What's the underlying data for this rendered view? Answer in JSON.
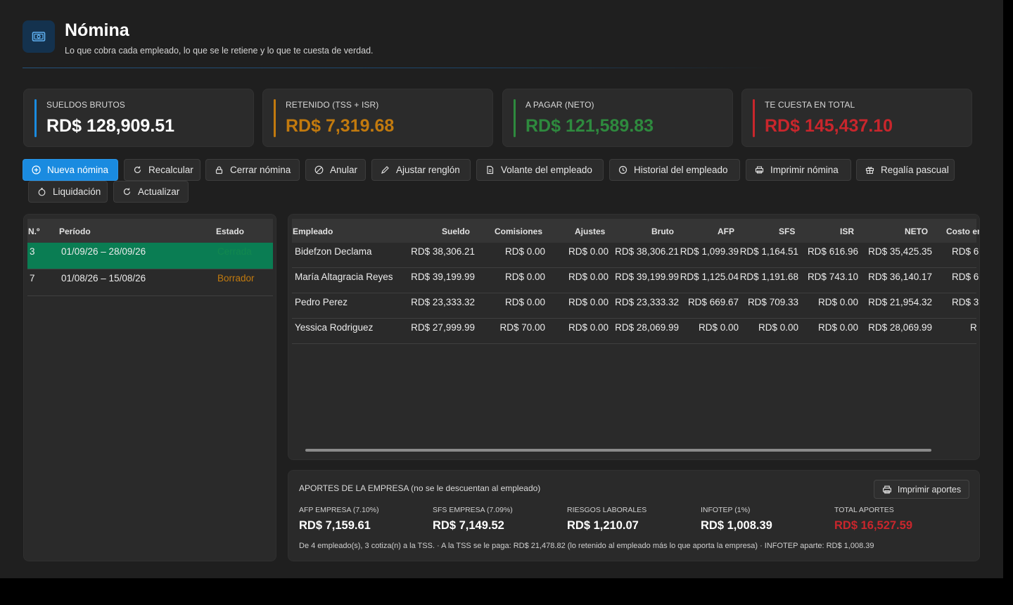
{
  "header": {
    "title": "Nómina",
    "subtitle": "Lo que cobra cada empleado, lo que se le retiene y lo que te cuesta de verdad.",
    "icon": "money-icon"
  },
  "stats": [
    {
      "label": "SUELDOS BRUTOS",
      "value": "RD$ 128,909.51",
      "color": "#1a8be0",
      "value_color": "#ffffff"
    },
    {
      "label": "RETENIDO (TSS + ISR)",
      "value": "RD$ 7,319.68",
      "color": "#c27a0e",
      "value_color": "#c27a0e"
    },
    {
      "label": "A PAGAR (NETO)",
      "value": "RD$ 121,589.83",
      "color": "#2e8a3e",
      "value_color": "#2e8a3e"
    },
    {
      "label": "TE CUESTA EN TOTAL",
      "value": "RD$ 145,437.10",
      "color": "#c9262c",
      "value_color": "#c9262c"
    }
  ],
  "toolbar": [
    {
      "label": "Nueva nómina",
      "icon": "plus-circle-icon"
    },
    {
      "label": "Recalcular",
      "icon": "refresh-icon"
    },
    {
      "label": "Cerrar nómina",
      "icon": "lock-icon"
    },
    {
      "label": "Anular",
      "icon": "cancel-icon"
    },
    {
      "label": "Ajustar renglón",
      "icon": "pencil-icon"
    },
    {
      "label": "Volante del empleado",
      "icon": "document-icon"
    },
    {
      "label": "Historial del empleado",
      "icon": "history-icon"
    },
    {
      "label": "Imprimir nómina",
      "icon": "printer-icon"
    },
    {
      "label": "Regalía pascual",
      "icon": "gift-icon"
    },
    {
      "label": "Liquidación",
      "icon": "stopwatch-icon"
    },
    {
      "label": "Actualizar",
      "icon": "refresh-icon"
    }
  ],
  "periods": {
    "columns": [
      "N.º",
      "Período",
      "Estado"
    ],
    "rows": [
      {
        "no": "3",
        "period": "01/09/26 – 28/09/26",
        "status": "Cerrada",
        "status_color": "#12884f",
        "selected": true
      },
      {
        "no": "7",
        "period": "01/08/26 – 15/08/26",
        "status": "Borrador",
        "status_color": "#c27a0e",
        "selected": false
      }
    ]
  },
  "employees": {
    "columns": [
      "Empleado",
      "Sueldo",
      "Comisiones",
      "Ajustes",
      "Bruto",
      "AFP",
      "SFS",
      "ISR",
      "NETO",
      "Costo em"
    ],
    "rows": [
      {
        "name": "Bidefzon Declama",
        "sueldo": "RD$ 38,306.21",
        "comisiones": "RD$ 0.00",
        "ajustes": "RD$ 0.00",
        "bruto": "RD$ 38,306.21",
        "afp": "RD$ 1,099.39",
        "sfs": "RD$ 1,164.51",
        "isr": "RD$ 616.96",
        "neto": "RD$ 35,425.35",
        "costo": "RD$ 6"
      },
      {
        "name": "María Altagracia Reyes",
        "sueldo": "RD$ 39,199.99",
        "comisiones": "RD$ 0.00",
        "ajustes": "RD$ 0.00",
        "bruto": "RD$ 39,199.99",
        "afp": "RD$ 1,125.04",
        "sfs": "RD$ 1,191.68",
        "isr": "RD$ 743.10",
        "neto": "RD$ 36,140.17",
        "costo": "RD$ 6"
      },
      {
        "name": "Pedro Perez",
        "sueldo": "RD$ 23,333.32",
        "comisiones": "RD$ 0.00",
        "ajustes": "RD$ 0.00",
        "bruto": "RD$ 23,333.32",
        "afp": "RD$ 669.67",
        "sfs": "RD$ 709.33",
        "isr": "RD$ 0.00",
        "neto": "RD$ 21,954.32",
        "costo": "RD$ 3"
      },
      {
        "name": "Yessica Rodriguez",
        "sueldo": "RD$ 27,999.99",
        "comisiones": "RD$ 70.00",
        "ajustes": "RD$ 0.00",
        "bruto": "RD$ 28,069.99",
        "afp": "RD$ 0.00",
        "sfs": "RD$ 0.00",
        "isr": "RD$ 0.00",
        "neto": "RD$ 28,069.99",
        "costo": "R"
      }
    ]
  },
  "aportes": {
    "title": "APORTES DE LA EMPRESA (no se le descuentan al empleado)",
    "print_label": "Imprimir aportes",
    "items": [
      {
        "label": "AFP EMPRESA (7.10%)",
        "value": "RD$ 7,159.61",
        "color": "#ffffff"
      },
      {
        "label": "SFS EMPRESA (7.09%)",
        "value": "RD$ 7,149.52",
        "color": "#ffffff"
      },
      {
        "label": "RIESGOS LABORALES",
        "value": "RD$ 1,210.07",
        "color": "#ffffff"
      },
      {
        "label": "INFOTEP (1%)",
        "value": "RD$ 1,008.39",
        "color": "#ffffff"
      },
      {
        "label": "TOTAL APORTES",
        "value": "RD$ 16,527.59",
        "color": "#c9262c"
      }
    ],
    "footer": "De 4 empleado(s), 3 cotiza(n) a la TSS.   ·   A la TSS se le paga: RD$ 21,478.82  (lo retenido al empleado más lo que aporta la empresa)   ·   INFOTEP aparte: RD$ 1,008.39"
  }
}
